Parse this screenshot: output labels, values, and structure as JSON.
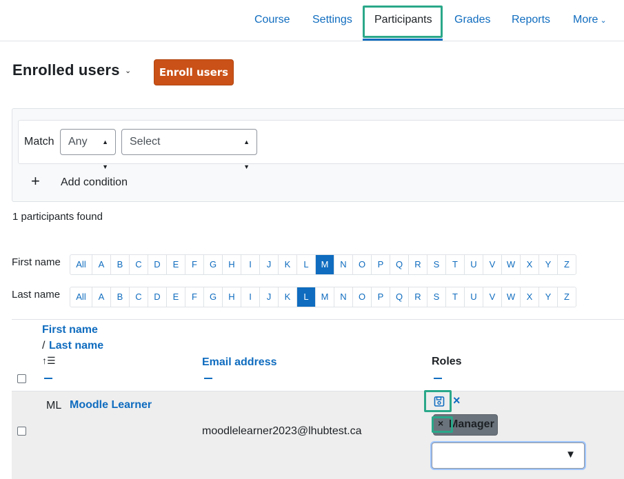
{
  "nav": {
    "tabs": [
      {
        "label": "Course"
      },
      {
        "label": "Settings"
      },
      {
        "label": "Participants"
      },
      {
        "label": "Grades"
      },
      {
        "label": "Reports"
      },
      {
        "label": "More"
      }
    ],
    "active_tab": "Participants"
  },
  "header": {
    "title": "Enrolled users",
    "enroll_button": "Enroll users"
  },
  "filter": {
    "match_label": "Match",
    "match_value": "Any",
    "select_value": "Select",
    "add_condition": "Add condition"
  },
  "participants_found": "1 participants found",
  "initials": {
    "first_name_label": "First name",
    "last_name_label": "Last name",
    "letters": [
      "All",
      "A",
      "B",
      "C",
      "D",
      "E",
      "F",
      "G",
      "H",
      "I",
      "J",
      "K",
      "L",
      "M",
      "N",
      "O",
      "P",
      "Q",
      "R",
      "S",
      "T",
      "U",
      "V",
      "W",
      "X",
      "Y",
      "Z"
    ],
    "first_selected": "M",
    "last_selected": "L"
  },
  "table": {
    "col_first_name": "First name",
    "col_slash": "/",
    "col_last_name": "Last name",
    "col_email": "Email address",
    "col_roles": "Roles",
    "rows": [
      {
        "initials": "ML",
        "name": "Moodle Learner",
        "email": "moodlelearner2023@lhubtest.ca",
        "role": "Manager"
      }
    ]
  },
  "colors": {
    "link": "#0f6cbf",
    "primary_button": "#ca5117",
    "highlight": "#2aa889"
  }
}
